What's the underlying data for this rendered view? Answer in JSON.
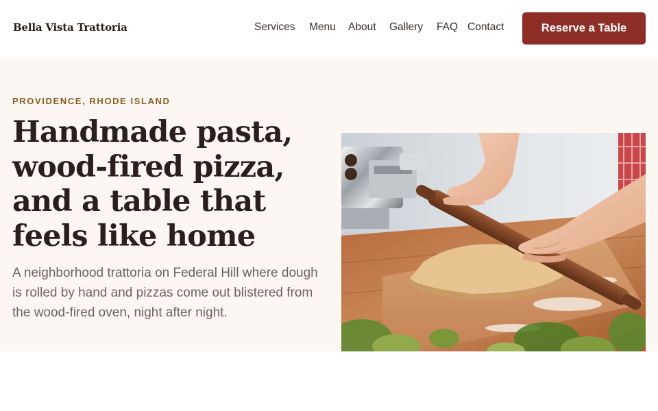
{
  "header": {
    "brand": "Bella Vista Trattoria",
    "nav": [
      {
        "label": "Services"
      },
      {
        "label": "Menu"
      },
      {
        "label": "About"
      },
      {
        "label": "Gallery"
      },
      {
        "label": "FAQ"
      },
      {
        "label": "Contact"
      }
    ],
    "cta_label": "Reserve a Table"
  },
  "hero": {
    "eyebrow": "PROVIDENCE, RHODE ISLAND",
    "headline": "Handmade pasta, wood-fired pizza, and a table that feels like home",
    "lede": "A neighborhood trattoria on Federal Hill where dough is rolled by hand and pizzas come out blistered from the wood-fired oven, night after night.",
    "image_subject": "hands-rolling-pasta-dough-photo"
  },
  "colors": {
    "accent": "#8d2e27",
    "eyebrow": "#8a5a22",
    "hero_background": "#fcf7f3",
    "heading_text": "#2a1f1a",
    "body_text": "#6e625b"
  }
}
